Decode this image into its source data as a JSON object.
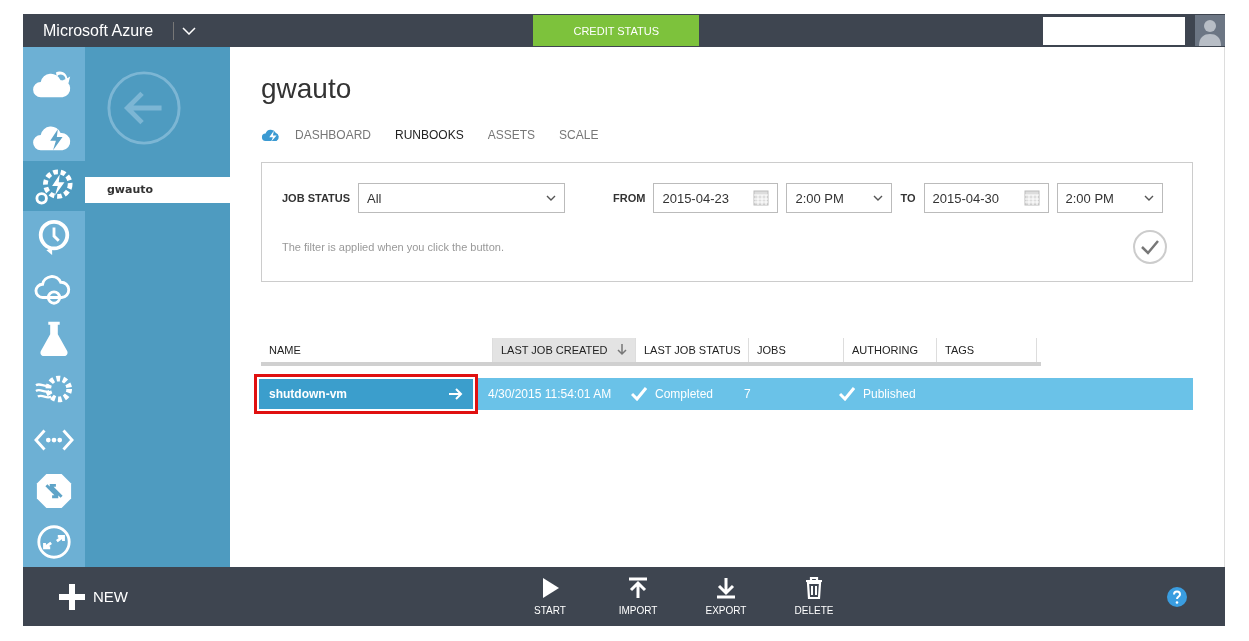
{
  "top_bar": {
    "brand": "Microsoft Azure",
    "credit_status": "CREDIT STATUS"
  },
  "nav_icons": [
    {
      "kind": "cloud-arrow",
      "selected": false
    },
    {
      "kind": "cloud-bolt",
      "selected": false
    },
    {
      "kind": "gear-bolt",
      "selected": true
    },
    {
      "kind": "clock",
      "selected": false
    },
    {
      "kind": "cloud-ring",
      "selected": false
    },
    {
      "kind": "flask",
      "selected": false
    },
    {
      "kind": "gear-wave",
      "selected": false
    },
    {
      "kind": "code",
      "selected": false
    },
    {
      "kind": "arrows",
      "selected": false
    },
    {
      "kind": "circle-arrows",
      "selected": false
    }
  ],
  "sub_nav": {
    "items": [
      {
        "label": "gwauto",
        "selected": true
      }
    ]
  },
  "page": {
    "title": "gwauto",
    "tabs": [
      {
        "label": "DASHBOARD",
        "selected": false
      },
      {
        "label": "RUNBOOKS",
        "selected": true
      },
      {
        "label": "ASSETS",
        "selected": false
      },
      {
        "label": "SCALE",
        "selected": false
      }
    ]
  },
  "filter": {
    "job_status_label": "JOB STATUS",
    "job_status": "All",
    "from_label": "FROM",
    "from_date": "2015-04-23",
    "from_time": "2:00 PM",
    "to_label": "TO",
    "to_date": "2015-04-30",
    "to_time": "2:00 PM",
    "hint": "The filter is applied when you click the button."
  },
  "table": {
    "columns": [
      {
        "label": "NAME",
        "sorted": false
      },
      {
        "label": "LAST JOB CREATED",
        "sorted": true
      },
      {
        "label": "LAST JOB STATUS",
        "sorted": false
      },
      {
        "label": "JOBS",
        "sorted": false
      },
      {
        "label": "AUTHORING",
        "sorted": false
      },
      {
        "label": "TAGS",
        "sorted": false
      }
    ],
    "rows": [
      {
        "name": "shutdown-vm",
        "last_job_created": "4/30/2015 11:54:01 AM",
        "last_job_status": "Completed",
        "jobs": "7",
        "authoring": "Published",
        "selected": true,
        "highlighted": true
      }
    ]
  },
  "command_bar": {
    "new": "NEW",
    "commands": [
      {
        "kind": "start",
        "label": "START"
      },
      {
        "kind": "import",
        "label": "IMPORT"
      },
      {
        "kind": "export",
        "label": "EXPORT"
      },
      {
        "kind": "delete",
        "label": "DELETE"
      }
    ]
  }
}
